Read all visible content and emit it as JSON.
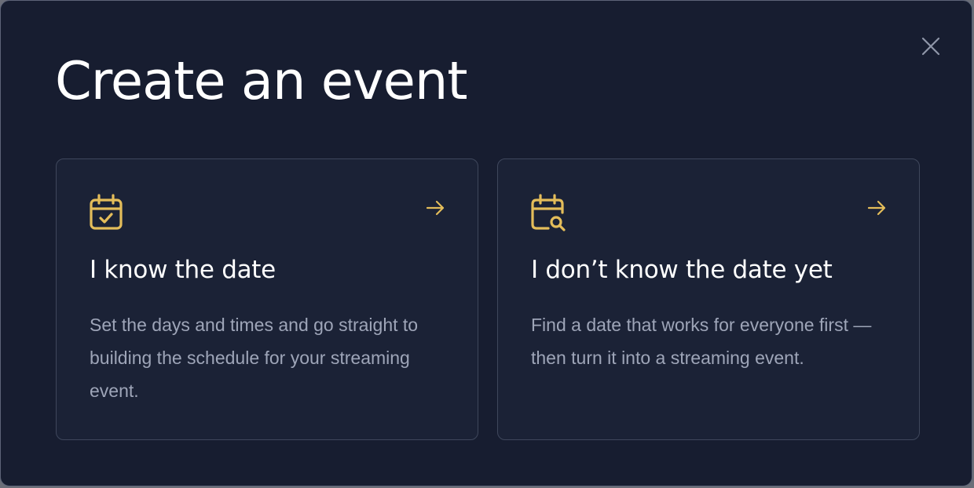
{
  "modal": {
    "title": "Create an event",
    "close_icon": "close-icon",
    "accent_color": "#e4bd5a",
    "options": [
      {
        "icon": "calendar-check-icon",
        "title": "I know the date",
        "description": "Set the days and times and go straight to building the schedule for your streaming event."
      },
      {
        "icon": "calendar-search-icon",
        "title": "I don’t know the date yet",
        "description": "Find a date that works for everyone first — then turn it into a streaming event."
      }
    ]
  }
}
